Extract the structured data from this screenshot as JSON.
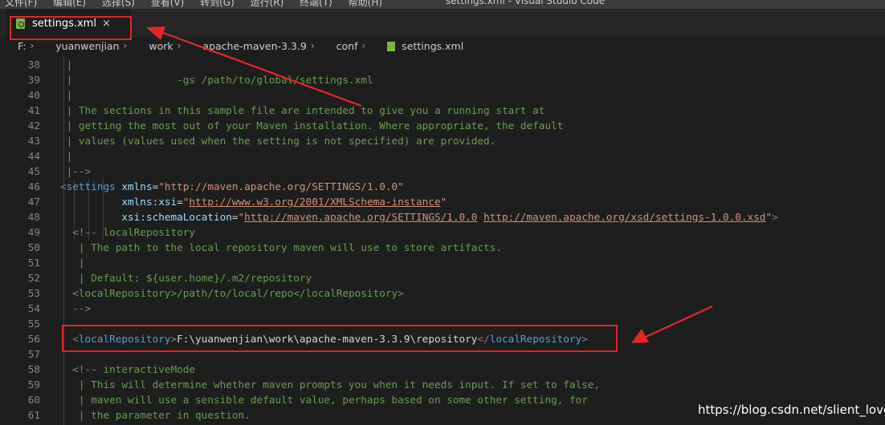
{
  "menubar": {
    "items": [
      "文件(F)",
      "编辑(E)",
      "选择(S)",
      "查看(V)",
      "转到(G)",
      "运行(R)",
      "终端(T)",
      "帮助(H)"
    ],
    "window_title": "settings.xml - Visual Studio Code"
  },
  "tab": {
    "label": "settings.xml",
    "icon": "xml-file-icon",
    "close": "×"
  },
  "breadcrumb": {
    "items": [
      "F:",
      "yuanwenjian",
      "work",
      "apache-maven-3.3.9",
      "conf"
    ],
    "file": "settings.xml",
    "separator": "›"
  },
  "lines": [
    {
      "n": "38",
      "segs": [
        {
          "t": " |",
          "k": "c"
        }
      ]
    },
    {
      "n": "39",
      "segs": [
        {
          "t": " |                 -gs /path/to/global/settings.xml",
          "k": "c"
        }
      ]
    },
    {
      "n": "40",
      "segs": [
        {
          "t": " |",
          "k": "c"
        }
      ]
    },
    {
      "n": "41",
      "segs": [
        {
          "t": " | The sections in this sample file are intended to give you a running start at",
          "k": "c"
        }
      ]
    },
    {
      "n": "42",
      "segs": [
        {
          "t": " | getting the most out of your Maven installation. Where appropriate, the default",
          "k": "c"
        }
      ]
    },
    {
      "n": "43",
      "segs": [
        {
          "t": " | values (values used when the setting is not specified) are provided.",
          "k": "c"
        }
      ]
    },
    {
      "n": "44",
      "segs": [
        {
          "t": " |",
          "k": "c"
        }
      ]
    },
    {
      "n": "45",
      "segs": [
        {
          "t": " |-->",
          "k": "c"
        }
      ]
    },
    {
      "n": "46",
      "segs": [
        {
          "t": "<",
          "k": "tg"
        },
        {
          "t": "settings",
          "k": "tn"
        },
        {
          "t": " ",
          "k": "tx"
        },
        {
          "t": "xmlns",
          "k": "an"
        },
        {
          "t": "=",
          "k": "tx"
        },
        {
          "t": "\"http://maven.apache.org/SETTINGS/1.0.0\"",
          "k": "av"
        }
      ]
    },
    {
      "n": "47",
      "segs": [
        {
          "t": "          ",
          "k": "tx"
        },
        {
          "t": "xmlns:xsi",
          "k": "an"
        },
        {
          "t": "=",
          "k": "tx"
        },
        {
          "t": "\"",
          "k": "av"
        },
        {
          "t": "http://www.w3.org/2001/XMLSchema-instance",
          "k": "av u"
        },
        {
          "t": "\"",
          "k": "av"
        }
      ]
    },
    {
      "n": "48",
      "segs": [
        {
          "t": "          ",
          "k": "tx"
        },
        {
          "t": "xsi:schemaLocation",
          "k": "an"
        },
        {
          "t": "=",
          "k": "tx"
        },
        {
          "t": "\"",
          "k": "av"
        },
        {
          "t": "http://maven.apache.org/SETTINGS/1.0.0",
          "k": "av u"
        },
        {
          "t": " ",
          "k": "av"
        },
        {
          "t": "http://maven.apache.org/xsd/settings-1.0.0.xsd",
          "k": "av u"
        },
        {
          "t": "\"",
          "k": "av"
        },
        {
          "t": ">",
          "k": "tg"
        }
      ]
    },
    {
      "n": "49",
      "segs": [
        {
          "t": "  <!-- localRepository",
          "k": "c"
        }
      ]
    },
    {
      "n": "50",
      "segs": [
        {
          "t": "   | The path to the local repository maven will use to store artifacts.",
          "k": "c"
        }
      ]
    },
    {
      "n": "51",
      "segs": [
        {
          "t": "   |",
          "k": "c"
        }
      ]
    },
    {
      "n": "52",
      "segs": [
        {
          "t": "   | Default: ${user.home}/.m2/repository",
          "k": "c"
        }
      ]
    },
    {
      "n": "53",
      "segs": [
        {
          "t": "  <localRepository>/path/to/local/repo</localRepository>",
          "k": "c"
        }
      ]
    },
    {
      "n": "54",
      "segs": [
        {
          "t": "  -->",
          "k": "c"
        }
      ]
    },
    {
      "n": "55",
      "segs": []
    },
    {
      "n": "56",
      "segs": [
        {
          "t": "  ",
          "k": "tx"
        },
        {
          "t": "<",
          "k": "tg"
        },
        {
          "t": "localRepository",
          "k": "tn"
        },
        {
          "t": ">",
          "k": "tg"
        },
        {
          "t": "F:\\yuanwenjian\\work\\apache-maven-3.3.9\\repository",
          "k": "tx"
        },
        {
          "t": "</",
          "k": "tg"
        },
        {
          "t": "localRepository",
          "k": "tn"
        },
        {
          "t": ">",
          "k": "tg"
        }
      ]
    },
    {
      "n": "57",
      "segs": []
    },
    {
      "n": "58",
      "segs": [
        {
          "t": "  <!-- interactiveMode",
          "k": "c"
        }
      ]
    },
    {
      "n": "59",
      "segs": [
        {
          "t": "   | This will determine whether maven prompts you when it needs input. If set to false,",
          "k": "c"
        }
      ]
    },
    {
      "n": "60",
      "segs": [
        {
          "t": "   | maven will use a sensible default value, perhaps based on some other setting, for",
          "k": "c"
        }
      ]
    },
    {
      "n": "61",
      "segs": [
        {
          "t": "   | the parameter in question.",
          "k": "c"
        }
      ]
    }
  ],
  "watermark": "https://blog.csdn.net/slient_love",
  "colors": {
    "comment": "#6a9955",
    "tag": "#569cd6",
    "attr": "#9cdcfe",
    "string": "#ce9178",
    "annotation_box": "#e0262b"
  }
}
